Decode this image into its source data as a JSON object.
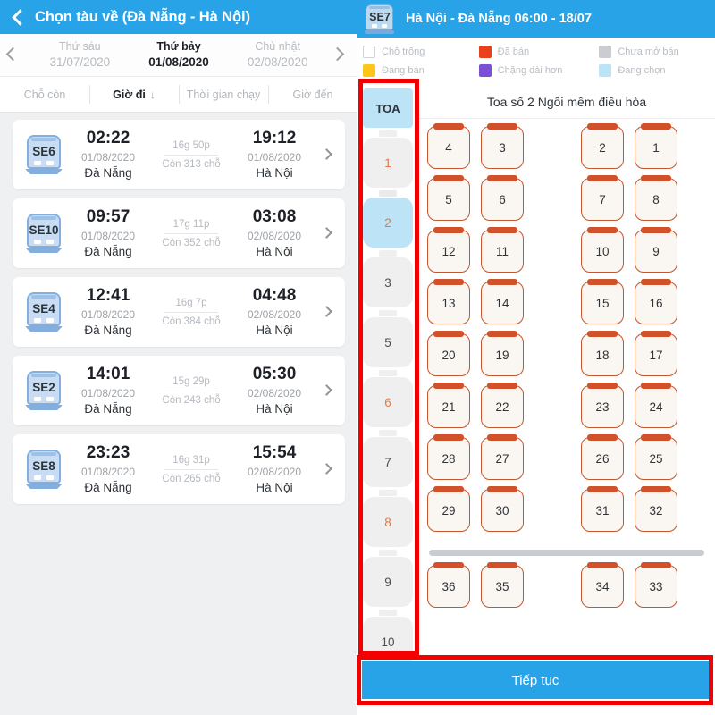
{
  "left": {
    "header": {
      "back_icon": "chevron-left-icon",
      "title": "Chọn tàu về (Đà Nẵng - Hà Nội)"
    },
    "date_nav": {
      "prev_icon": "chevron-left-icon",
      "next_icon": "chevron-right-icon",
      "dates": [
        {
          "dow": "Thứ sáu",
          "date": "31/07/2020",
          "active": false
        },
        {
          "dow": "Thứ bảy",
          "date": "01/08/2020",
          "active": true
        },
        {
          "dow": "Chủ nhật",
          "date": "02/08/2020",
          "active": false
        }
      ]
    },
    "filters": [
      {
        "label": "Chỗ còn",
        "active": false,
        "arrow": ""
      },
      {
        "label": "Giờ đi",
        "active": true,
        "arrow": "↓"
      },
      {
        "label": "Thời gian chạy",
        "active": false,
        "arrow": ""
      },
      {
        "label": "Giờ đến",
        "active": false,
        "arrow": ""
      }
    ],
    "trains": [
      {
        "code": "SE6",
        "dep_time": "02:22",
        "dep_date": "01/08/2020",
        "dep_station": "Đà Nẵng",
        "duration": "16g 50p",
        "seats": "Còn 313 chỗ",
        "arr_time": "19:12",
        "arr_date": "01/08/2020",
        "arr_station": "Hà Nội"
      },
      {
        "code": "SE10",
        "dep_time": "09:57",
        "dep_date": "01/08/2020",
        "dep_station": "Đà Nẵng",
        "duration": "17g 11p",
        "seats": "Còn 352 chỗ",
        "arr_time": "03:08",
        "arr_date": "02/08/2020",
        "arr_station": "Hà Nội"
      },
      {
        "code": "SE4",
        "dep_time": "12:41",
        "dep_date": "01/08/2020",
        "dep_station": "Đà Nẵng",
        "duration": "16g 7p",
        "seats": "Còn 384 chỗ",
        "arr_time": "04:48",
        "arr_date": "02/08/2020",
        "arr_station": "Hà Nội"
      },
      {
        "code": "SE2",
        "dep_time": "14:01",
        "dep_date": "01/08/2020",
        "dep_station": "Đà Nẵng",
        "duration": "15g 29p",
        "seats": "Còn 243 chỗ",
        "arr_time": "05:30",
        "arr_date": "02/08/2020",
        "arr_station": "Hà Nội"
      },
      {
        "code": "SE8",
        "dep_time": "23:23",
        "dep_date": "01/08/2020",
        "dep_station": "Đà Nẵng",
        "duration": "16g 31p",
        "seats": "Còn 265 chỗ",
        "arr_time": "15:54",
        "arr_date": "02/08/2020",
        "arr_station": "Hà Nội"
      }
    ]
  },
  "right": {
    "header": {
      "train_code": "SE7",
      "route": "Hà Nội - Đà Nẵng  06:00 - 18/07"
    },
    "legend": [
      {
        "label": "Chỗ trống",
        "color": "#ffffff",
        "border": "#cfd4da"
      },
      {
        "label": "Đã bán",
        "color": "#e8401c",
        "border": "#e8401c"
      },
      {
        "label": "Chưa mở bán",
        "color": "#c9cdd2",
        "border": "#c9cdd2"
      },
      {
        "label": "Đang bán",
        "color": "#ffc61a",
        "border": "#ffc61a"
      },
      {
        "label": "Chặng dài hơn",
        "color": "#7b4fd6",
        "border": "#7b4fd6"
      },
      {
        "label": "Đang chọn",
        "color": "#bde3f7",
        "border": "#bde3f7"
      }
    ],
    "coach_column": {
      "header": "TOA",
      "coaches": [
        {
          "label": "1",
          "selected": false,
          "orange": true
        },
        {
          "label": "2",
          "selected": true,
          "orange": true
        },
        {
          "label": "3",
          "selected": false,
          "orange": false
        },
        {
          "label": "5",
          "selected": false,
          "orange": false
        },
        {
          "label": "6",
          "selected": false,
          "orange": true
        },
        {
          "label": "7",
          "selected": false,
          "orange": false
        },
        {
          "label": "8",
          "selected": false,
          "orange": true
        },
        {
          "label": "9",
          "selected": false,
          "orange": false
        },
        {
          "label": "10",
          "selected": false,
          "orange": false
        }
      ]
    },
    "cabin": {
      "title": "Toa số 2  Ngồi mềm điều hòa",
      "seat_rows": [
        {
          "left": [
            "4",
            "3"
          ],
          "right": [
            "2",
            "1"
          ]
        },
        {
          "left": [
            "5",
            "6"
          ],
          "right": [
            "7",
            "8"
          ]
        },
        {
          "left": [
            "12",
            "11"
          ],
          "right": [
            "10",
            "9"
          ]
        },
        {
          "left": [
            "13",
            "14"
          ],
          "right": [
            "15",
            "16"
          ]
        },
        {
          "left": [
            "20",
            "19"
          ],
          "right": [
            "18",
            "17"
          ]
        },
        {
          "left": [
            "21",
            "22"
          ],
          "right": [
            "23",
            "24"
          ]
        },
        {
          "left": [
            "28",
            "27"
          ],
          "right": [
            "26",
            "25"
          ]
        },
        {
          "left": [
            "29",
            "30"
          ],
          "right": [
            "31",
            "32"
          ]
        }
      ],
      "seat_rows_after_scroll": [
        {
          "left": [
            "36",
            "35"
          ],
          "right": [
            "34",
            "33"
          ]
        }
      ]
    },
    "cta": {
      "label": "Tiếp tục"
    }
  },
  "annotations": {
    "accent_color": "#f40000",
    "boxes": [
      "coach-column-highlight",
      "continue-button-highlight"
    ]
  }
}
